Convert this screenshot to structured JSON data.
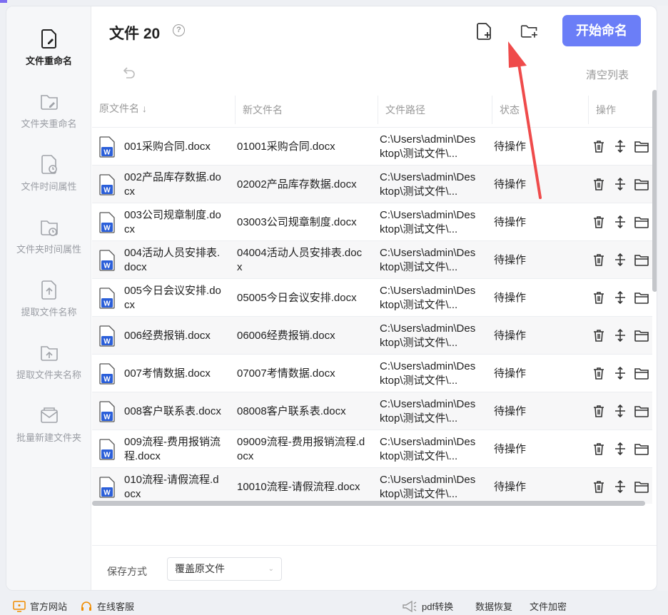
{
  "sidebar": {
    "items": [
      {
        "label": "文件重命名",
        "icon": "file-edit-icon",
        "active": true
      },
      {
        "label": "文件夹重命名",
        "icon": "folder-edit-icon"
      },
      {
        "label": "文件时间属性",
        "icon": "file-clock-icon"
      },
      {
        "label": "文件夹时间属性",
        "icon": "folder-clock-icon"
      },
      {
        "label": "提取文件名称",
        "icon": "file-upload-icon"
      },
      {
        "label": "提取文件夹名称",
        "icon": "folder-upload-icon"
      },
      {
        "label": "批量新建文件夹",
        "icon": "mail-folder-icon"
      }
    ]
  },
  "header": {
    "title": "文件 20",
    "help": "?",
    "start_button": "开始命名",
    "clear_list": "清空列表"
  },
  "table": {
    "columns": [
      "原文件名",
      "新文件名",
      "文件路径",
      "状态",
      "操作"
    ],
    "rows": [
      {
        "orig": "001采购合同.docx",
        "new": "01001采购合同.docx",
        "path": "C:\\Users\\admin\\Desktop\\测试文件\\...",
        "status": "待操作"
      },
      {
        "orig": "002产品库存数据.docx",
        "new": "02002产品库存数据.docx",
        "path": "C:\\Users\\admin\\Desktop\\测试文件\\...",
        "status": "待操作"
      },
      {
        "orig": "003公司规章制度.docx",
        "new": "03003公司规章制度.docx",
        "path": "C:\\Users\\admin\\Desktop\\测试文件\\...",
        "status": "待操作"
      },
      {
        "orig": "004活动人员安排表.docx",
        "new": "04004活动人员安排表.docx",
        "path": "C:\\Users\\admin\\Desktop\\测试文件\\...",
        "status": "待操作"
      },
      {
        "orig": "005今日会议安排.docx",
        "new": "05005今日会议安排.docx",
        "path": "C:\\Users\\admin\\Desktop\\测试文件\\...",
        "status": "待操作"
      },
      {
        "orig": "006经费报销.docx",
        "new": "06006经费报销.docx",
        "path": "C:\\Users\\admin\\Desktop\\测试文件\\...",
        "status": "待操作"
      },
      {
        "orig": "007考情数据.docx",
        "new": "07007考情数据.docx",
        "path": "C:\\Users\\admin\\Desktop\\测试文件\\...",
        "status": "待操作"
      },
      {
        "orig": "008客户联系表.docx",
        "new": "08008客户联系表.docx",
        "path": "C:\\Users\\admin\\Desktop\\测试文件\\...",
        "status": "待操作"
      },
      {
        "orig": "009流程-费用报销流程.docx",
        "new": "09009流程-费用报销流程.docx",
        "path": "C:\\Users\\admin\\Desktop\\测试文件\\...",
        "status": "待操作"
      },
      {
        "orig": "010流程-请假流程.docx",
        "new": "10010流程-请假流程.docx",
        "path": "C:\\Users\\admin\\Desktop\\测试文件\\...",
        "status": "待操作"
      }
    ]
  },
  "bottom": {
    "save_label": "保存方式",
    "save_value": "覆盖原文件"
  },
  "footer": {
    "official_site": "官方网站",
    "online_service": "在线客服",
    "pdf": "pdf转换",
    "recovery": "数据恢复",
    "encrypt": "文件加密"
  },
  "colors": {
    "accent": "#6b7ef7",
    "annotation_arrow": "#ef4b4b",
    "word_blue": "#2b5fd9"
  }
}
